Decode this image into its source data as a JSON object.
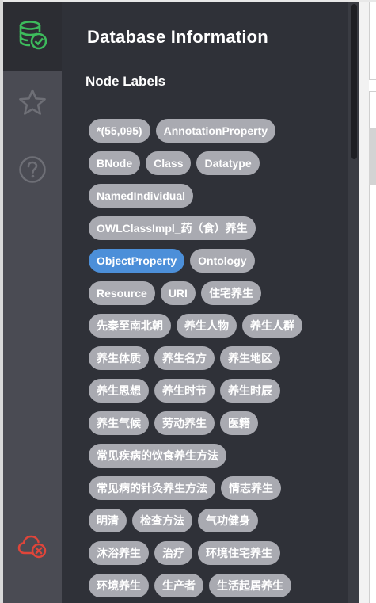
{
  "sidebar": {
    "items": [
      {
        "name": "database",
        "icon": "database-check-icon",
        "active": true
      },
      {
        "name": "favorites",
        "icon": "star-icon"
      },
      {
        "name": "help",
        "icon": "question-circle-icon"
      },
      {
        "name": "connection",
        "icon": "cloud-disconnect-icon"
      }
    ]
  },
  "panel": {
    "title": "Database Information",
    "section_title": "Node Labels",
    "labels": [
      {
        "text": "*(55,095)"
      },
      {
        "text": "AnnotationProperty"
      },
      {
        "text": "BNode"
      },
      {
        "text": "Class"
      },
      {
        "text": "Datatype"
      },
      {
        "text": "NamedIndividual"
      },
      {
        "text": "OWLClassImpl_药（食）养生"
      },
      {
        "text": "ObjectProperty",
        "active": true
      },
      {
        "text": "Ontology"
      },
      {
        "text": "Resource"
      },
      {
        "text": "URI"
      },
      {
        "text": "住宅养生"
      },
      {
        "text": "先秦至南北朝"
      },
      {
        "text": "养生人物"
      },
      {
        "text": "养生人群"
      },
      {
        "text": "养生体质"
      },
      {
        "text": "养生名方"
      },
      {
        "text": "养生地区"
      },
      {
        "text": "养生思想"
      },
      {
        "text": "养生时节"
      },
      {
        "text": "养生时辰"
      },
      {
        "text": "养生气候"
      },
      {
        "text": "劳动养生"
      },
      {
        "text": "医籍"
      },
      {
        "text": "常见疾病的饮食养生方法"
      },
      {
        "text": "常见病的针灸养生方法"
      },
      {
        "text": "情志养生"
      },
      {
        "text": "明清"
      },
      {
        "text": "检查方法"
      },
      {
        "text": "气功健身"
      },
      {
        "text": "沐浴养生"
      },
      {
        "text": "治疗"
      },
      {
        "text": "环境住宅养生"
      },
      {
        "text": "环境养生"
      },
      {
        "text": "生产者"
      },
      {
        "text": "生活起居养生"
      }
    ]
  },
  "colors": {
    "sidebar_bg": "#4a4b53",
    "sidebar_active_bg": "#2c2d33",
    "panel_bg": "#2f3138",
    "pill_bg": "#a9aab1",
    "pill_active_bg": "#4c8fd9",
    "db_icon_color": "#3dbb5c",
    "disconnect_icon_color": "#e0453a",
    "inactive_icon_color": "#6e6f76"
  }
}
